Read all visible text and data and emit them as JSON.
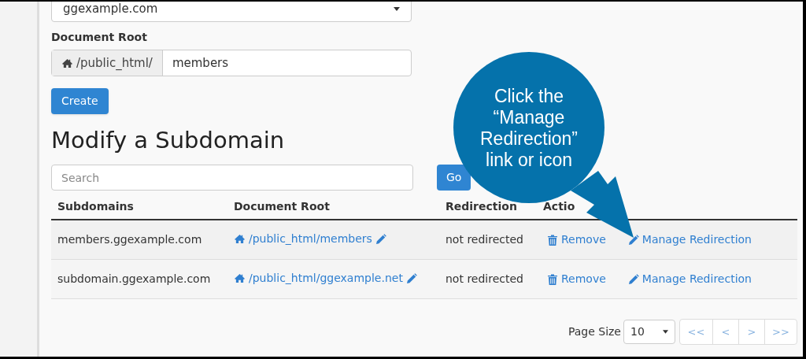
{
  "domain_select": {
    "value": "ggexample.com"
  },
  "document_root": {
    "label": "Document Root",
    "prefix": "/public_html/",
    "value": "members"
  },
  "create_button": "Create",
  "modify_title": "Modify a Subdomain",
  "search": {
    "placeholder": "Search"
  },
  "go_button": "Go",
  "table": {
    "columns": [
      "Subdomains",
      "Document Root",
      "Redirection",
      "Actio"
    ],
    "rows": [
      {
        "subdomain": "members.ggexample.com",
        "root": "/public_html/members",
        "redirection": "not redirected",
        "remove": "Remove",
        "manage": "Manage Redirection"
      },
      {
        "subdomain": "subdomain.ggexample.com",
        "root": "/public_html/ggexample.net",
        "redirection": "not redirected",
        "remove": "Remove",
        "manage": "Manage Redirection"
      }
    ]
  },
  "pagination": {
    "label": "Page Size",
    "page_size": "10",
    "buttons": [
      "<<",
      "<",
      ">",
      ">>"
    ]
  },
  "callout": {
    "lines": [
      "Click the",
      "“Manage",
      "Redirection”",
      "link or icon"
    ]
  }
}
